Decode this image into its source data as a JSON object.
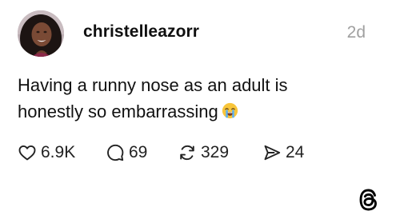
{
  "post": {
    "author": {
      "username": "christelleazorr",
      "avatar_icon": "profile-photo-avatar"
    },
    "timestamp": "2d",
    "text_lines": [
      "Having a runny nose as an adult is",
      "honestly so embarrassing"
    ],
    "text_emoji": "loudly-crying-face-emoji",
    "actions": {
      "like": {
        "icon": "heart-icon",
        "count": "6.9K"
      },
      "reply": {
        "icon": "comment-bubble-icon",
        "count": "69"
      },
      "repost": {
        "icon": "repost-arrows-icon",
        "count": "329"
      },
      "share": {
        "icon": "send-paper-plane-icon",
        "count": "24"
      }
    }
  },
  "branding": {
    "logo_icon": "threads-logo-icon"
  },
  "colors": {
    "background": "#ffffff",
    "text": "#111111",
    "muted": "#a0a0a0",
    "emoji_face": "#f8c53a",
    "emoji_tears": "#5fb0f0"
  }
}
